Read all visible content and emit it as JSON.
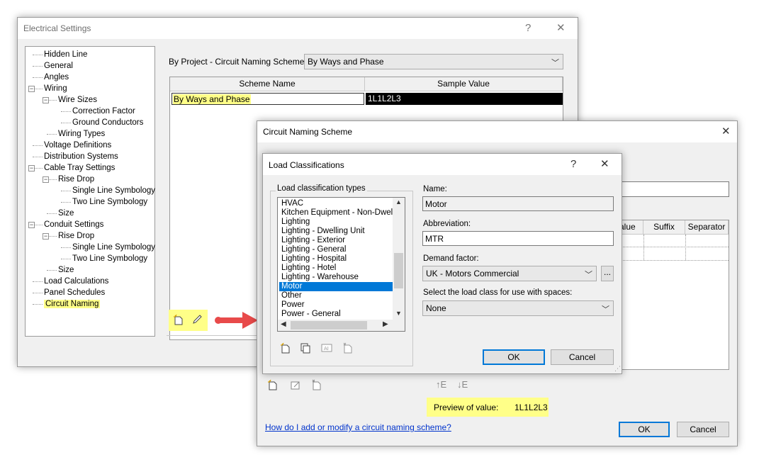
{
  "electrical_settings": {
    "title": "Electrical Settings",
    "help": "?",
    "close": "✕",
    "tree": [
      {
        "label": "Hidden Line",
        "level": 1
      },
      {
        "label": "General",
        "level": 1
      },
      {
        "label": "Angles",
        "level": 1
      },
      {
        "label": "Wiring",
        "level": 1,
        "toggle": "−"
      },
      {
        "label": "Wire Sizes",
        "level": 2,
        "toggle": "−"
      },
      {
        "label": "Correction Factor",
        "level": 3
      },
      {
        "label": "Ground Conductors",
        "level": 3
      },
      {
        "label": "Wiring Types",
        "level": 2
      },
      {
        "label": "Voltage Definitions",
        "level": 1
      },
      {
        "label": "Distribution Systems",
        "level": 1
      },
      {
        "label": "Cable Tray Settings",
        "level": 1,
        "toggle": "−"
      },
      {
        "label": "Rise Drop",
        "level": 2,
        "toggle": "−"
      },
      {
        "label": "Single Line Symbology",
        "level": 3
      },
      {
        "label": "Two Line Symbology",
        "level": 3
      },
      {
        "label": "Size",
        "level": 2
      },
      {
        "label": "Conduit Settings",
        "level": 1,
        "toggle": "−"
      },
      {
        "label": "Rise Drop",
        "level": 2,
        "toggle": "−"
      },
      {
        "label": "Single Line Symbology",
        "level": 3
      },
      {
        "label": "Two Line Symbology",
        "level": 3
      },
      {
        "label": "Size",
        "level": 2
      },
      {
        "label": "Load Calculations",
        "level": 1
      },
      {
        "label": "Panel Schedules",
        "level": 1
      },
      {
        "label": "Circuit Naming",
        "level": 1,
        "highlight": true
      }
    ],
    "scheme_label": "By Project - Circuit Naming Scheme:",
    "scheme_value": "By Ways and Phase",
    "table_headers": [
      "Scheme Name",
      "Sample Value"
    ],
    "table_row": [
      "By Ways and Phase",
      "1L1L2L3"
    ]
  },
  "circuit_naming": {
    "title": "Circuit Naming Scheme",
    "close": "✕",
    "col_headers": [
      "alue",
      "Suffix",
      "Separator"
    ],
    "preview_label": "Preview of value:",
    "preview_value": "1L1L2L3",
    "help_link": "How do I add or modify a circuit naming scheme?",
    "ok": "OK",
    "cancel": "Cancel"
  },
  "load_classifications": {
    "title": "Load Classifications",
    "help": "?",
    "close": "✕",
    "group_label": "Load classification types",
    "items": [
      "HVAC",
      "Kitchen Equipment - Non-Dwelling",
      "Lighting",
      "Lighting - Dwelling Unit",
      "Lighting - Exterior",
      "Lighting - General",
      "Lighting - Hospital",
      "Lighting - Hotel",
      "Lighting - Warehouse",
      "Motor",
      "Other",
      "Power",
      "Power - General"
    ],
    "selected": "Motor",
    "name_label": "Name:",
    "name_value": "Motor",
    "abbrev_label": "Abbreviation:",
    "abbrev_value": "MTR",
    "demand_label": "Demand factor:",
    "demand_value": "UK - Motors Commercial",
    "ellipsis": "...",
    "space_label": "Select the load class for use with spaces:",
    "space_value": "None",
    "ok": "OK",
    "cancel": "Cancel"
  },
  "colors": {
    "highlight": "#ffff88",
    "selection": "#0078d7",
    "arrow": "#e84a4a",
    "link": "#0033cc"
  }
}
